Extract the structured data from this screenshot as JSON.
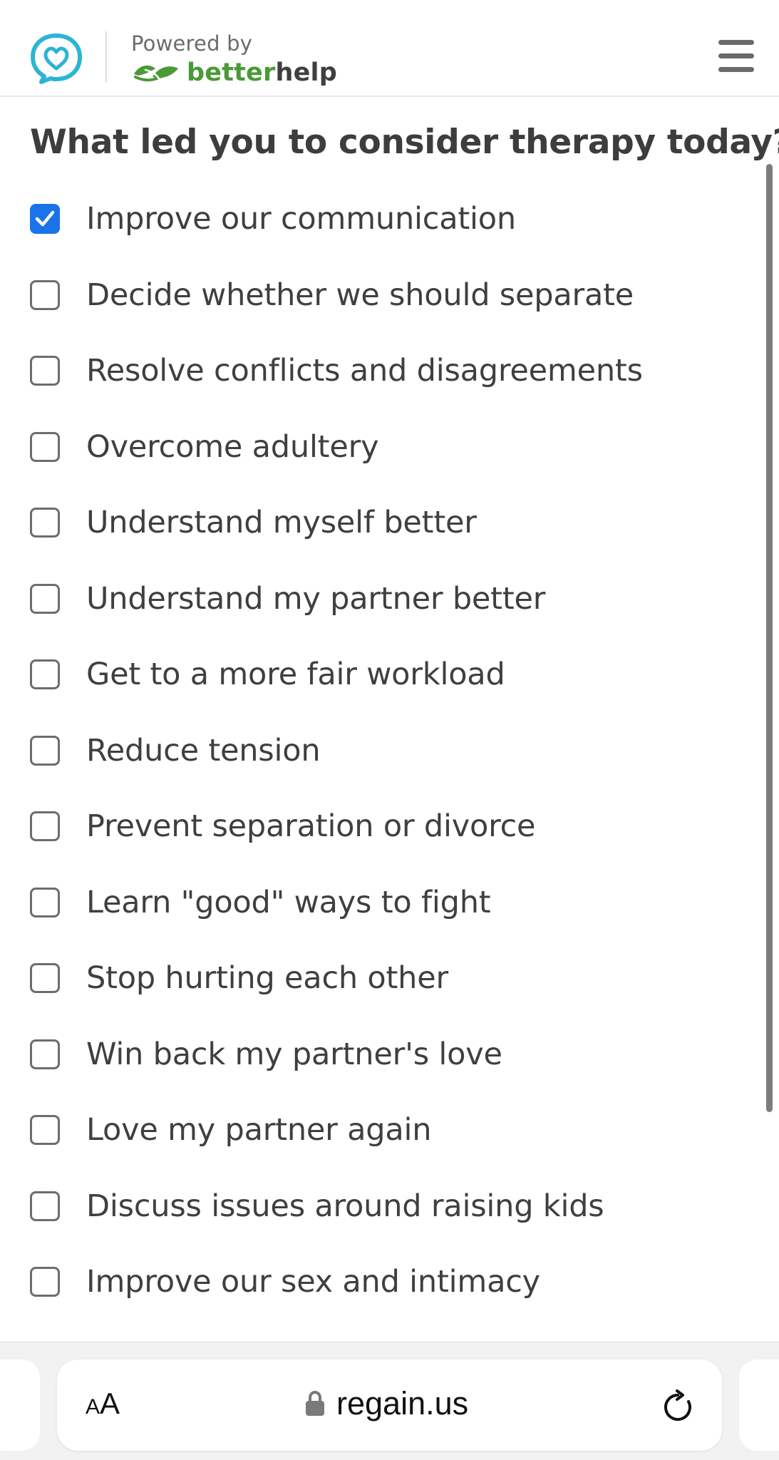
{
  "header": {
    "powered_by": "Powered by",
    "brand_better": "better",
    "brand_help": "help",
    "logo_icon": "heart-chat-bubble-icon",
    "menu_icon": "hamburger-menu-icon",
    "colors": {
      "logo": "#2cb4d6",
      "brand_green": "#4a9a36"
    }
  },
  "question": "What led you to consider therapy today?",
  "options": [
    {
      "label": "Improve our communication",
      "checked": true
    },
    {
      "label": "Decide whether we should separate",
      "checked": false
    },
    {
      "label": "Resolve conflicts and disagreements",
      "checked": false
    },
    {
      "label": "Overcome adultery",
      "checked": false
    },
    {
      "label": "Understand myself better",
      "checked": false
    },
    {
      "label": "Understand my partner better",
      "checked": false
    },
    {
      "label": "Get to a more fair workload",
      "checked": false
    },
    {
      "label": "Reduce tension",
      "checked": false
    },
    {
      "label": "Prevent separation or divorce",
      "checked": false
    },
    {
      "label": "Learn \"good\" ways to fight",
      "checked": false
    },
    {
      "label": "Stop hurting each other",
      "checked": false
    },
    {
      "label": "Win back my partner's love",
      "checked": false
    },
    {
      "label": "Love my partner again",
      "checked": false
    },
    {
      "label": "Discuss issues around raising kids",
      "checked": false
    },
    {
      "label": "Improve our sex and intimacy",
      "checked": false
    }
  ],
  "checkbox_color": "#1a73e8",
  "browser": {
    "aa_small": "A",
    "aa_big": "A",
    "url": "regain.us",
    "lock_icon": "lock-icon",
    "reload_icon": "reload-icon"
  }
}
